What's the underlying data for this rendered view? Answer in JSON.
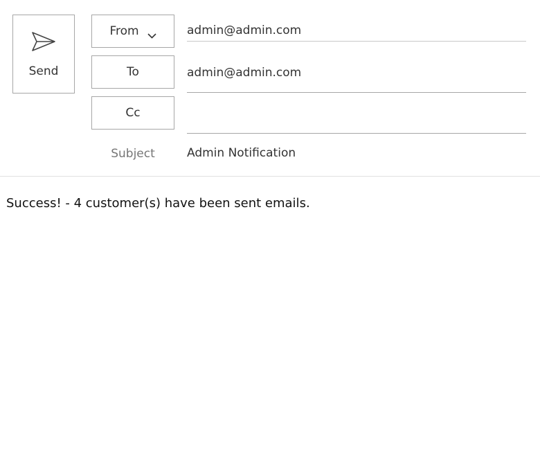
{
  "compose": {
    "send_label": "Send",
    "from_label": "From",
    "to_label": "To",
    "cc_label": "Cc",
    "subject_label": "Subject",
    "from_value": "admin@admin.com",
    "to_value": "admin@admin.com",
    "cc_value": "",
    "subject_value": "Admin Notification"
  },
  "message": {
    "body": "Success! - 4 customer(s) have been sent emails."
  },
  "icons": {
    "send": "send-icon",
    "from_dropdown": "chevron-down-icon"
  }
}
